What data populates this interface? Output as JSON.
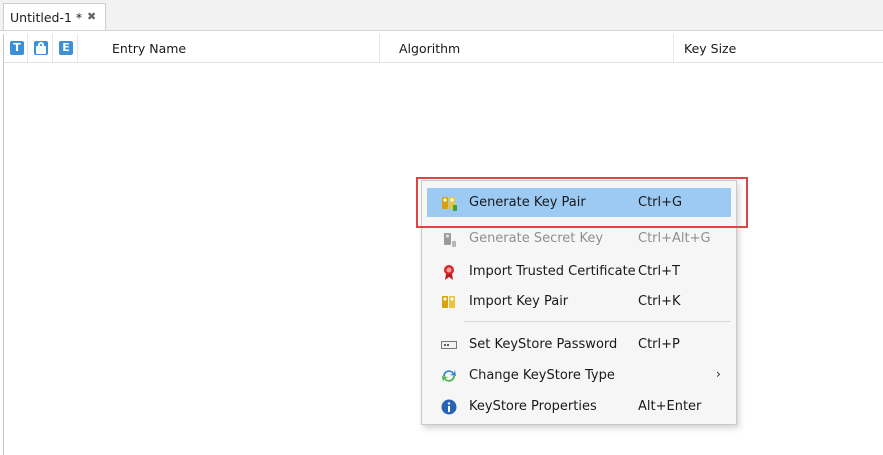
{
  "tab": {
    "title": "Untitled-1 *",
    "close_glyph": "✖"
  },
  "table": {
    "icon_columns": [
      "T",
      "lock",
      "E"
    ],
    "columns": [
      "Entry Name",
      "Algorithm",
      "Key Size"
    ]
  },
  "context_menu": {
    "items": [
      {
        "label": "Generate Key Pair",
        "accel": "Ctrl+G",
        "icon": "key-pair-icon",
        "highlighted": true
      },
      {
        "label": "Generate Secret Key",
        "accel": "Ctrl+Alt+G",
        "icon": "secret-key-icon",
        "disabled": true
      },
      {
        "label": "Import Trusted Certificate",
        "accel": "Ctrl+T",
        "icon": "certificate-icon"
      },
      {
        "label": "Import Key Pair",
        "accel": "Ctrl+K",
        "icon": "key-pair-icon"
      },
      {
        "label": "Set KeyStore Password",
        "accel": "Ctrl+P",
        "icon": "password-icon"
      },
      {
        "label": "Change KeyStore Type",
        "accel": "",
        "icon": "change-type-icon",
        "submenu_glyph": "›"
      },
      {
        "label": "KeyStore Properties",
        "accel": "Alt+Enter",
        "icon": "info-icon"
      }
    ]
  },
  "colors": {
    "menu_highlight": "#9ccaf3",
    "annotation_box": "#e04545",
    "header_icon": "#3d8fd6"
  }
}
